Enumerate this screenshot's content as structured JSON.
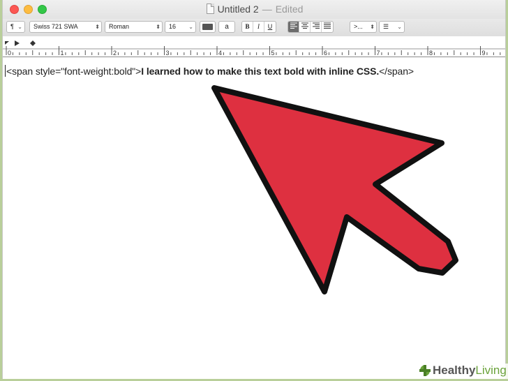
{
  "window": {
    "title": "Untitled 2",
    "title_separator": "—",
    "status": "Edited"
  },
  "toolbar": {
    "paragraph_style": "¶",
    "font_family": "Swiss 721 SWA",
    "typeface": "Roman",
    "font_size": "16",
    "text_color": "#555555",
    "text_color_label": "a",
    "bold": "B",
    "italic": "I",
    "underline": "U",
    "alignment_selected": "left",
    "spacing": ">...",
    "list_style": "☰"
  },
  "ruler": {
    "labels": [
      "0",
      "1",
      "2",
      "3",
      "4",
      "5",
      "6",
      "7",
      "8",
      "9"
    ]
  },
  "document": {
    "open_tag": "<span style=\"font-weight:bold\">",
    "bold_text": "I learned how to make this text bold with inline CSS.",
    "close_tag": "</span>"
  },
  "annotation": {
    "arrow_color": "#de3040"
  },
  "watermark": {
    "brand_first": "Healthy",
    "brand_second": "Living"
  }
}
